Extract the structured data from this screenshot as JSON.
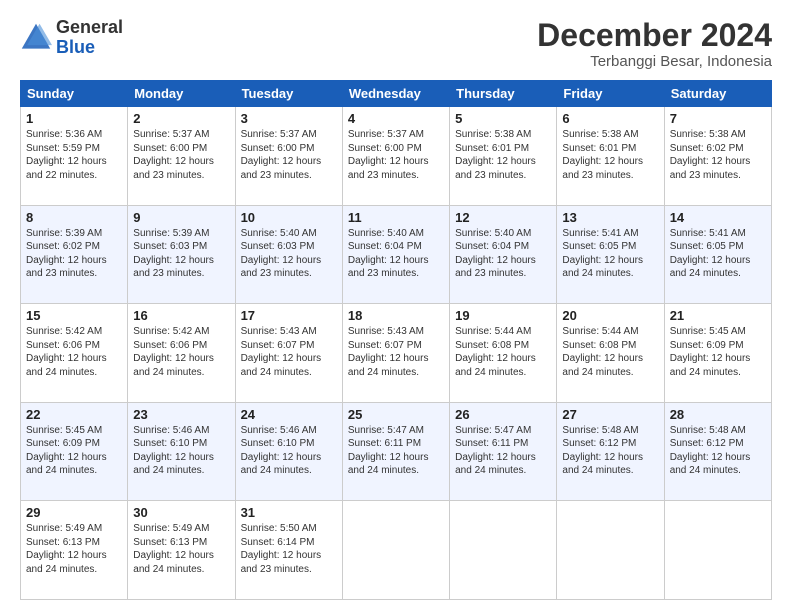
{
  "logo": {
    "line1": "General",
    "line2": "Blue"
  },
  "title": "December 2024",
  "subtitle": "Terbanggi Besar, Indonesia",
  "days_of_week": [
    "Sunday",
    "Monday",
    "Tuesday",
    "Wednesday",
    "Thursday",
    "Friday",
    "Saturday"
  ],
  "weeks": [
    [
      {
        "day": "1",
        "info": "Sunrise: 5:36 AM\nSunset: 5:59 PM\nDaylight: 12 hours\nand 22 minutes."
      },
      {
        "day": "2",
        "info": "Sunrise: 5:37 AM\nSunset: 6:00 PM\nDaylight: 12 hours\nand 23 minutes."
      },
      {
        "day": "3",
        "info": "Sunrise: 5:37 AM\nSunset: 6:00 PM\nDaylight: 12 hours\nand 23 minutes."
      },
      {
        "day": "4",
        "info": "Sunrise: 5:37 AM\nSunset: 6:00 PM\nDaylight: 12 hours\nand 23 minutes."
      },
      {
        "day": "5",
        "info": "Sunrise: 5:38 AM\nSunset: 6:01 PM\nDaylight: 12 hours\nand 23 minutes."
      },
      {
        "day": "6",
        "info": "Sunrise: 5:38 AM\nSunset: 6:01 PM\nDaylight: 12 hours\nand 23 minutes."
      },
      {
        "day": "7",
        "info": "Sunrise: 5:38 AM\nSunset: 6:02 PM\nDaylight: 12 hours\nand 23 minutes."
      }
    ],
    [
      {
        "day": "8",
        "info": "Sunrise: 5:39 AM\nSunset: 6:02 PM\nDaylight: 12 hours\nand 23 minutes."
      },
      {
        "day": "9",
        "info": "Sunrise: 5:39 AM\nSunset: 6:03 PM\nDaylight: 12 hours\nand 23 minutes."
      },
      {
        "day": "10",
        "info": "Sunrise: 5:40 AM\nSunset: 6:03 PM\nDaylight: 12 hours\nand 23 minutes."
      },
      {
        "day": "11",
        "info": "Sunrise: 5:40 AM\nSunset: 6:04 PM\nDaylight: 12 hours\nand 23 minutes."
      },
      {
        "day": "12",
        "info": "Sunrise: 5:40 AM\nSunset: 6:04 PM\nDaylight: 12 hours\nand 23 minutes."
      },
      {
        "day": "13",
        "info": "Sunrise: 5:41 AM\nSunset: 6:05 PM\nDaylight: 12 hours\nand 24 minutes."
      },
      {
        "day": "14",
        "info": "Sunrise: 5:41 AM\nSunset: 6:05 PM\nDaylight: 12 hours\nand 24 minutes."
      }
    ],
    [
      {
        "day": "15",
        "info": "Sunrise: 5:42 AM\nSunset: 6:06 PM\nDaylight: 12 hours\nand 24 minutes."
      },
      {
        "day": "16",
        "info": "Sunrise: 5:42 AM\nSunset: 6:06 PM\nDaylight: 12 hours\nand 24 minutes."
      },
      {
        "day": "17",
        "info": "Sunrise: 5:43 AM\nSunset: 6:07 PM\nDaylight: 12 hours\nand 24 minutes."
      },
      {
        "day": "18",
        "info": "Sunrise: 5:43 AM\nSunset: 6:07 PM\nDaylight: 12 hours\nand 24 minutes."
      },
      {
        "day": "19",
        "info": "Sunrise: 5:44 AM\nSunset: 6:08 PM\nDaylight: 12 hours\nand 24 minutes."
      },
      {
        "day": "20",
        "info": "Sunrise: 5:44 AM\nSunset: 6:08 PM\nDaylight: 12 hours\nand 24 minutes."
      },
      {
        "day": "21",
        "info": "Sunrise: 5:45 AM\nSunset: 6:09 PM\nDaylight: 12 hours\nand 24 minutes."
      }
    ],
    [
      {
        "day": "22",
        "info": "Sunrise: 5:45 AM\nSunset: 6:09 PM\nDaylight: 12 hours\nand 24 minutes."
      },
      {
        "day": "23",
        "info": "Sunrise: 5:46 AM\nSunset: 6:10 PM\nDaylight: 12 hours\nand 24 minutes."
      },
      {
        "day": "24",
        "info": "Sunrise: 5:46 AM\nSunset: 6:10 PM\nDaylight: 12 hours\nand 24 minutes."
      },
      {
        "day": "25",
        "info": "Sunrise: 5:47 AM\nSunset: 6:11 PM\nDaylight: 12 hours\nand 24 minutes."
      },
      {
        "day": "26",
        "info": "Sunrise: 5:47 AM\nSunset: 6:11 PM\nDaylight: 12 hours\nand 24 minutes."
      },
      {
        "day": "27",
        "info": "Sunrise: 5:48 AM\nSunset: 6:12 PM\nDaylight: 12 hours\nand 24 minutes."
      },
      {
        "day": "28",
        "info": "Sunrise: 5:48 AM\nSunset: 6:12 PM\nDaylight: 12 hours\nand 24 minutes."
      }
    ],
    [
      {
        "day": "29",
        "info": "Sunrise: 5:49 AM\nSunset: 6:13 PM\nDaylight: 12 hours\nand 24 minutes."
      },
      {
        "day": "30",
        "info": "Sunrise: 5:49 AM\nSunset: 6:13 PM\nDaylight: 12 hours\nand 24 minutes."
      },
      {
        "day": "31",
        "info": "Sunrise: 5:50 AM\nSunset: 6:14 PM\nDaylight: 12 hours\nand 23 minutes."
      },
      {
        "day": "",
        "info": ""
      },
      {
        "day": "",
        "info": ""
      },
      {
        "day": "",
        "info": ""
      },
      {
        "day": "",
        "info": ""
      }
    ]
  ]
}
